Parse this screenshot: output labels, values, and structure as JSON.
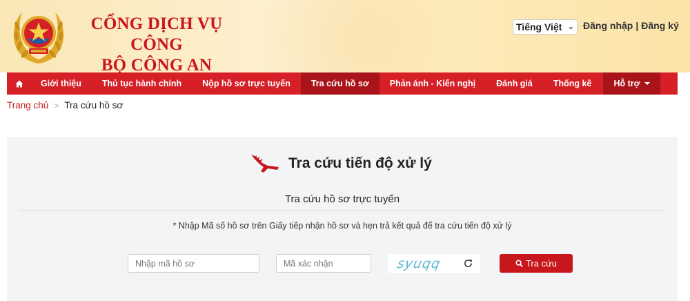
{
  "header": {
    "title_line1": "CỔNG DỊCH VỤ CÔNG",
    "title_line2": "BỘ CÔNG AN",
    "language": "Tiếng Việt",
    "login": "Đăng nhập",
    "separator": "|",
    "register": "Đăng ký",
    "logo_icon": "police-emblem-icon"
  },
  "nav": {
    "home_icon": "home-icon",
    "items": [
      "Giới thiệu",
      "Thủ tục hành chính",
      "Nộp hồ sơ trực tuyến",
      "Tra cứu hồ sơ",
      "Phản ánh - Kiến nghị",
      "Đánh giá",
      "Thống kê",
      "Hỗ trợ"
    ],
    "active_index": 3
  },
  "breadcrumb": {
    "home": "Trang chủ",
    "current": "Tra cứu hồ sơ"
  },
  "lookup": {
    "title": "Tra cứu tiến độ xử lý",
    "subtitle": "Tra cứu hồ sơ trực tuyến",
    "note": "* Nhập Mã số hồ sơ trên Giấy tiếp nhận hồ sơ và hẹn trả kết quả để tra cứu tiến độ xử lý",
    "code_placeholder": "Nhập mã hồ sơ",
    "captcha_placeholder": "Mã xác nhận",
    "captcha_text": "syuqq",
    "search_label": "Tra cứu",
    "search_icon": "search-icon",
    "refresh_icon": "refresh-icon"
  },
  "colors": {
    "brand_red": "#d61f26",
    "nav_active": "#a8141a",
    "header_bg": "#fdf0cf",
    "captcha": "#5ab7cf"
  }
}
